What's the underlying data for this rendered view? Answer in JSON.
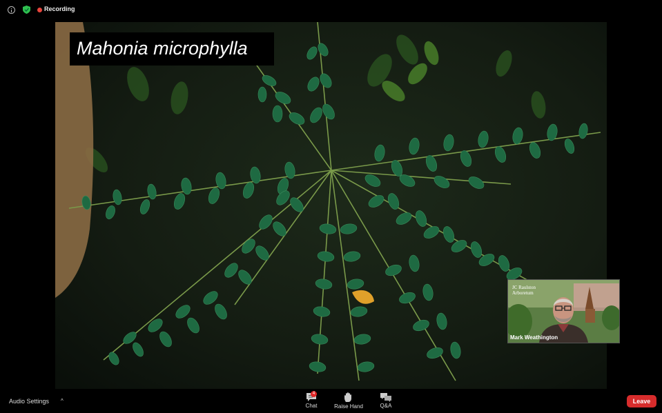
{
  "top_bar": {
    "recording_label": "Recording",
    "recording_color": "#e8453c",
    "shield_color": "#2fbf4f",
    "icons": [
      "info-icon",
      "shield-icon"
    ]
  },
  "shared_video": {
    "caption": "Mahonia microphylla"
  },
  "participant": {
    "name": "Mark Weathington",
    "logo_text": "JC Raulston Arboretum"
  },
  "bottom_bar": {
    "audio_settings_label": "Audio Settings",
    "audio_caret": "^",
    "controls": [
      {
        "label": "Chat",
        "icon": "chat-icon",
        "badge": "4"
      },
      {
        "label": "Raise Hand",
        "icon": "hand-icon"
      },
      {
        "label": "Q&A",
        "icon": "qa-icon"
      }
    ],
    "leave_label": "Leave",
    "leave_color": "#d72c2c"
  }
}
